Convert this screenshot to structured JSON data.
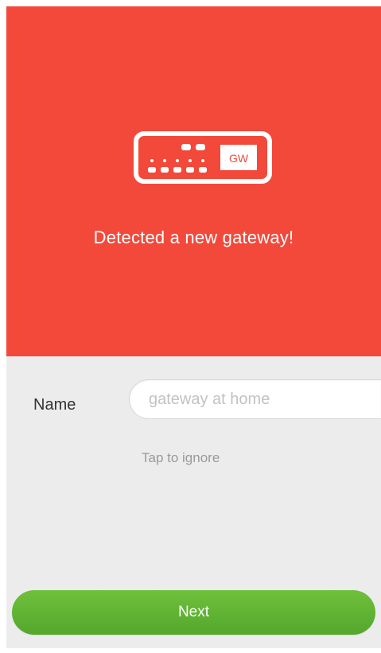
{
  "colors": {
    "hero_background": "#f2493a",
    "panel_background": "#ececec",
    "next_button": "#5cb232"
  },
  "hero": {
    "icon": "gateway-icon",
    "icon_badge": "GW",
    "title": "Detected a new gateway!"
  },
  "form": {
    "name_label": "Name",
    "name_value": "",
    "name_placeholder": "gateway at home",
    "ignore_text": "Tap to ignore"
  },
  "footer": {
    "next_label": "Next"
  }
}
